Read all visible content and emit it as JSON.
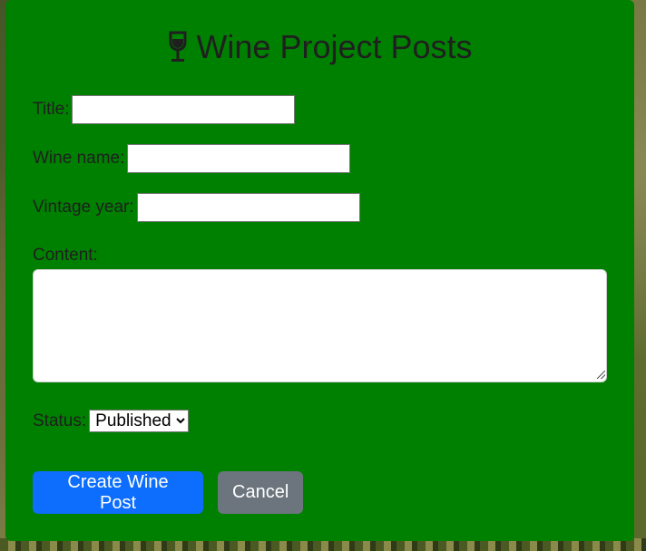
{
  "form": {
    "title": "Wine Project Posts",
    "icon": "wine-glass-icon",
    "fields": {
      "title": {
        "label": "Title:",
        "value": ""
      },
      "wine_name": {
        "label": "Wine name:",
        "value": ""
      },
      "vintage_year": {
        "label": "Vintage year:",
        "value": ""
      },
      "content": {
        "label": "Content:",
        "value": ""
      }
    },
    "status": {
      "label": "Status:",
      "selected": "Published"
    },
    "buttons": {
      "create": "Create Wine Post",
      "cancel": "Cancel"
    }
  },
  "colors": {
    "panel": "#008000",
    "primary": "#0d6efd",
    "secondary": "#6c757d"
  }
}
